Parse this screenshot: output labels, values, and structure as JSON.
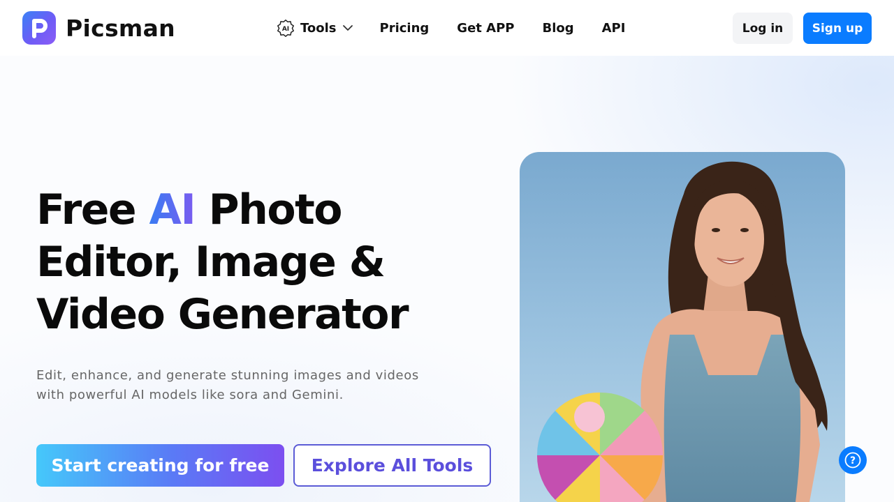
{
  "brand": {
    "name": "Picsman",
    "logo_letter": "P"
  },
  "nav": {
    "tools_badge": "AI",
    "tools_label": "Tools",
    "links": [
      "Pricing",
      "Get APP",
      "Blog",
      "API"
    ]
  },
  "auth": {
    "login": "Log in",
    "signup": "Sign up"
  },
  "hero": {
    "title_part1": "Free ",
    "title_ai": "AI",
    "title_part2": " Photo Editor, Image & Video Generator",
    "subtitle": "Edit, enhance, and generate stunning images and videos with powerful AI models like sora and Gemini.",
    "cta_primary": "Start creating for free",
    "cta_secondary": "Explore All Tools"
  },
  "help": {
    "label": "?"
  },
  "colors": {
    "brand_blue": "#0a7cff",
    "accent_purple": "#5b4fdc",
    "ai_gradient_start": "#3a7bf2",
    "ai_gradient_end": "#7a5cf0"
  },
  "icons": [
    "ai-badge-icon",
    "chevron-down-icon",
    "help-icon"
  ]
}
